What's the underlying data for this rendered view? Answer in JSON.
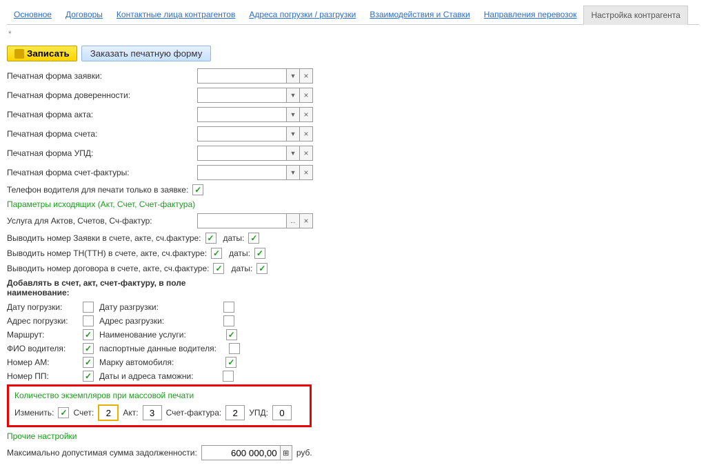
{
  "tabs": [
    "Основное",
    "Договоры",
    "Контактные лица контрагентов",
    "Адреса погрузки / разгрузки",
    "Взаимодействия и Ставки",
    "Направления перевозок",
    "Настройка контрагента"
  ],
  "activeTab": 6,
  "toolbar": {
    "save": "Записать",
    "order": "Заказать печатную форму"
  },
  "star": "*",
  "rows": {
    "r1": "Печатная форма заявки:",
    "r2": "Печатная форма доверенности:",
    "r3": "Печатная форма акта:",
    "r4": "Печатная форма счета:",
    "r5": "Печатная форма УПД:",
    "r6": "Печатная форма счет-фактуры:",
    "r7": "Телефон водителя для печати только в заявке:"
  },
  "sect1": "Параметры исходящих (Акт, Счет, Счет-фактура)",
  "svc": "Услуга для Актов, Счетов, Сч-фактур:",
  "out": {
    "o1": "Выводить номер Заявки в счете, акте, сч.фактуре:",
    "o2": "Выводить номер ТН(ТТН) в счете, акте, сч.фактуре:",
    "o3": "Выводить номер договора в счете, акте, сч.фактуре:",
    "dates": "даты:"
  },
  "addHdr": "Добавлять в счет, акт, счет-фактуру, в поле наименование:",
  "add": {
    "a1l": "Дату погрузки:",
    "a1r": "Дату разгрузки:",
    "a2l": "Адрес погрузки:",
    "a2r": "Адрес разгрузки:",
    "a3l": "Маршрут:",
    "a3r": "Наименование услуги:",
    "a4l": "ФИО водителя:",
    "a4r": "паспортные данные водителя:",
    "a5l": "Номер АМ:",
    "a5r": "Марку автомобиля:",
    "a6l": "Номер ПП:",
    "a6r": "Даты и адреса таможни:"
  },
  "copies": {
    "hdr": "Количество экземпляров при массовой печати",
    "change": "Изменить:",
    "schet": "Счет:",
    "schetV": "2",
    "akt": "Акт:",
    "aktV": "3",
    "sf": "Счет-фактура:",
    "sfV": "2",
    "upd": "УПД:",
    "updV": "0"
  },
  "other": "Прочие настройки",
  "debt": {
    "lbl": "Максимально допустимая сумма задолженности:",
    "val": "600 000,00",
    "rub": "руб."
  }
}
